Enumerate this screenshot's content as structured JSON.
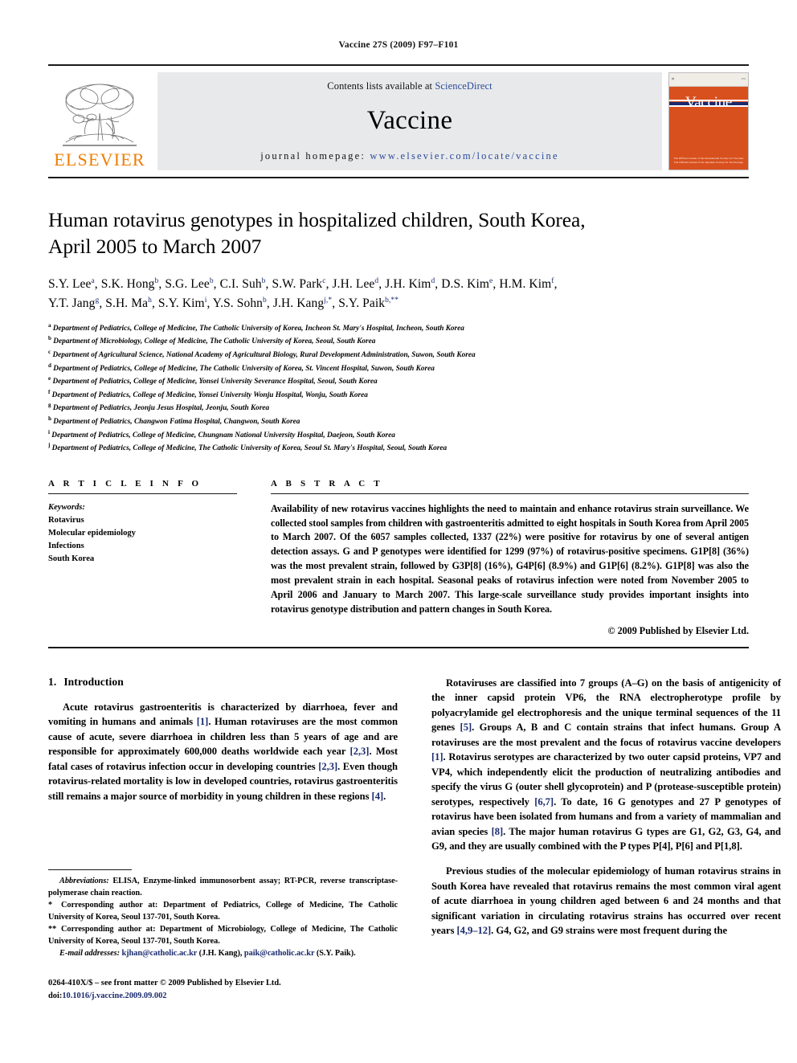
{
  "running_head": "Vaccine 27S (2009) F97–F101",
  "masthead": {
    "publisher_name": "ELSEVIER",
    "contents_prefix": "Contents lists available at ",
    "sciencedirect": "ScienceDirect",
    "journal_title": "Vaccine",
    "homepage_prefix": "journal homepage: ",
    "homepage_url": "www.elsevier.com/locate/vaccine",
    "cover": {
      "title": "Vaccine",
      "footer_line1": "The Official Journal of the International Society for Vaccines",
      "footer_line2": "The Official Journal of the Japanese Society for Vaccinology"
    }
  },
  "article": {
    "title_line1": "Human rotavirus genotypes in hospitalized children, South Korea,",
    "title_line2": "April 2005 to March 2007",
    "authors_line1": "S.Y. Lee a, S.K. Hong b, S.G. Lee b, C.I. Suh b, S.W. Park c, J.H. Lee d, J.H. Kim d, D.S. Kim e, H.M. Kim f,",
    "authors_line2": "Y.T. Jang g, S.H. Ma h, S.Y. Kim i, Y.S. Sohn b, J.H. Kang j,*, S.Y. Paik b,**",
    "affiliations": [
      {
        "marker": "a",
        "text": "Department of Pediatrics, College of Medicine, The Catholic University of Korea, Incheon St. Mary's Hospital, Incheon, South Korea"
      },
      {
        "marker": "b",
        "text": "Department of Microbiology, College of Medicine, The Catholic University of Korea, Seoul, South Korea"
      },
      {
        "marker": "c",
        "text": "Department of Agricultural Science, National Academy of Agricultural Biology, Rural Development Administration, Suwon, South Korea"
      },
      {
        "marker": "d",
        "text": "Department of Pediatrics, College of Medicine, The Catholic University of Korea, St. Vincent Hospital, Suwon, South Korea"
      },
      {
        "marker": "e",
        "text": "Department of Pediatrics, College of Medicine, Yonsei University Severance Hospital, Seoul, South Korea"
      },
      {
        "marker": "f",
        "text": "Department of Pediatrics, College of Medicine, Yonsei University Wonju Hospital, Wonju, South Korea"
      },
      {
        "marker": "g",
        "text": "Department of Pediatrics, Jeonju Jesus Hospital, Jeonju, South Korea"
      },
      {
        "marker": "h",
        "text": "Department of Pediatrics, Changwon Fatima Hospital, Changwon, South Korea"
      },
      {
        "marker": "i",
        "text": "Department of Pediatrics, College of Medicine, Chungnam National University Hospital, Daejeon, South Korea"
      },
      {
        "marker": "j",
        "text": "Department of Pediatrics, College of Medicine, The Catholic University of Korea, Seoul St. Mary's Hospital, Seoul, South Korea"
      }
    ]
  },
  "article_info": {
    "heading": "A R T I C L E   I N F O",
    "keywords_label": "Keywords:",
    "keywords": [
      "Rotavirus",
      "Molecular epidemiology",
      "Infections",
      "South Korea"
    ]
  },
  "abstract": {
    "heading": "A B S T R A C T",
    "text": "Availability of new rotavirus vaccines highlights the need to maintain and enhance rotavirus strain surveillance. We collected stool samples from children with gastroenteritis admitted to eight hospitals in South Korea from April 2005 to March 2007. Of the 6057 samples collected, 1337 (22%) were positive for rotavirus by one of several antigen detection assays. G and P genotypes were identified for 1299 (97%) of rotavirus-positive specimens. G1P[8] (36%) was the most prevalent strain, followed by G3P[8] (16%), G4P[6] (8.9%) and G1P[6] (8.2%). G1P[8] was also the most prevalent strain in each hospital. Seasonal peaks of rotavirus infection were noted from November 2005 to April 2006 and January to March 2007. This large-scale surveillance study provides important insights into rotavirus genotype distribution and pattern changes in South Korea.",
    "copyright": "© 2009 Published by Elsevier Ltd."
  },
  "body": {
    "section_number": "1.",
    "section_title": "Introduction",
    "left_paragraph_1_a": "Acute rotavirus gastroenteritis is characterized by diarrhoea, fever and vomiting in humans and animals ",
    "ref1": "[1]",
    "left_paragraph_1_b": ". Human rotaviruses are the most common cause of acute, severe diarrhoea in children less than 5 years of age and are responsible for approximately 600,000 deaths worldwide each year ",
    "ref23a": "[2,3]",
    "left_paragraph_1_c": ". Most fatal cases of rotavirus infection occur in developing countries ",
    "ref23b": "[2,3]",
    "left_paragraph_1_d": ". Even though rotavirus-related mortality is low in developed countries, rotavirus gastroenteritis still remains a major source of morbidity in young children in these regions ",
    "ref4": "[4]",
    "left_paragraph_1_e": ".",
    "right_paragraph_1_a": "Rotaviruses are classified into 7 groups (A–G) on the basis of antigenicity of the inner capsid protein VP6, the RNA electropherotype profile by polyacrylamide gel electrophoresis and the unique terminal sequences of the 11 genes ",
    "ref5": "[5]",
    "right_paragraph_1_b": ". Groups A, B and C contain strains that infect humans. Group A rotaviruses are the most prevalent and the focus of rotavirus vaccine developers ",
    "ref1b": "[1]",
    "right_paragraph_1_c": ". Rotavirus serotypes are characterized by two outer capsid proteins, VP7 and VP4, which independently elicit the production of neutralizing antibodies and specify the virus G (outer shell glycoprotein) and P (protease-susceptible protein) serotypes, respectively ",
    "ref67": "[6,7]",
    "right_paragraph_1_d": ". To date, 16 G genotypes and 27 P genotypes of rotavirus have been isolated from humans and from a variety of mammalian and avian species ",
    "ref8": "[8]",
    "right_paragraph_1_e": ". The major human rotavirus G types are G1, G2, G3, G4, and G9, and they are usually combined with the P types P[4], P[6] and P[1,8].",
    "right_paragraph_2_a": "Previous studies of the molecular epidemiology of human rotavirus strains in South Korea have revealed that rotavirus remains the most common viral agent of acute diarrhoea in young children aged between 6 and 24 months and that significant variation in circulating rotavirus strains has occurred over recent years ",
    "ref4912": "[4,9–12]",
    "right_paragraph_2_b": ". G4, G2, and G9 strains were most frequent during the"
  },
  "footnotes": {
    "abbrev_label": "Abbreviations:",
    "abbrev_text": " ELISA, Enzyme-linked immunosorbent assay; RT-PCR, reverse transcriptase-polymerase chain reaction.",
    "corresponding_1_marker": "*",
    "corresponding_1": "Corresponding author at: Department of Pediatrics, College of Medicine, The Catholic University of Korea, Seoul 137-701, South Korea.",
    "corresponding_2_marker": "**",
    "corresponding_2": "Corresponding author at: Department of Microbiology, College of Medicine, The Catholic University of Korea, Seoul 137-701, South Korea.",
    "email_label": "E-mail addresses:",
    "email_1": "kjhan@catholic.ac.kr",
    "email_1_owner": " (J.H. Kang), ",
    "email_2": "paik@catholic.ac.kr",
    "email_2_owner": " (S.Y. Paik)."
  },
  "publisher_footer": {
    "issn_line": "0264-410X/$ – see front matter © 2009 Published by Elsevier Ltd.",
    "doi_prefix": "doi:",
    "doi_value": "10.1016/j.vaccine.2009.09.002"
  },
  "colors": {
    "elsevier_orange": "#f07d00",
    "link_blue": "#2b4a9b",
    "reference_blue": "#1a2a6e",
    "band_gray": "#e8e9eb",
    "cover_orange": "#d8501d"
  }
}
